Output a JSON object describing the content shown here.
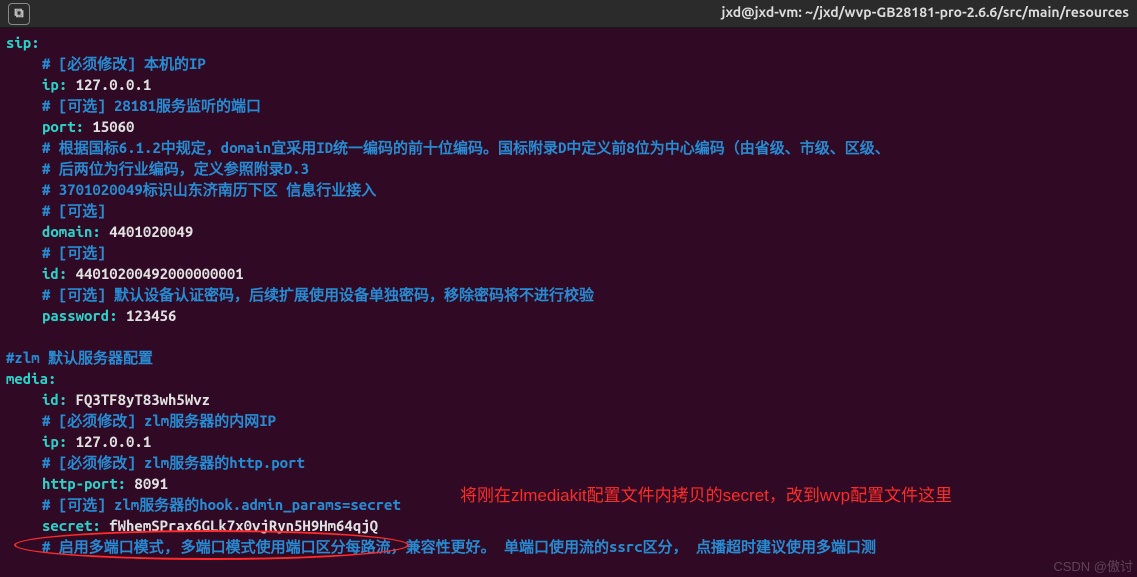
{
  "titlebar": {
    "title": "jxd@jxd-vm: ~/jxd/wvp-GB28181-pro-2.6.6/src/main/resources",
    "new_tab_icon_glyph": "⧉"
  },
  "lines": [
    {
      "indent": 0,
      "type": "key",
      "key": "sip",
      "value": ""
    },
    {
      "indent": 1,
      "type": "comment",
      "text": "# [必须修改] 本机的IP"
    },
    {
      "indent": 1,
      "type": "kv",
      "key": "ip",
      "value": "127.0.0.1"
    },
    {
      "indent": 1,
      "type": "comment",
      "text": "# [可选] 28181服务监听的端口"
    },
    {
      "indent": 1,
      "type": "kv",
      "key": "port",
      "value": "15060"
    },
    {
      "indent": 1,
      "type": "comment",
      "text": "# 根据国标6.1.2中规定，domain宜采用ID统一编码的前十位编码。国标附录D中定义前8位为中心编码（由省级、市级、区级、"
    },
    {
      "indent": 1,
      "type": "comment",
      "text": "# 后两位为行业编码，定义参照附录D.3"
    },
    {
      "indent": 1,
      "type": "comment",
      "text": "# 3701020049标识山东济南历下区 信息行业接入"
    },
    {
      "indent": 1,
      "type": "comment",
      "text": "# [可选]"
    },
    {
      "indent": 1,
      "type": "kv",
      "key": "domain",
      "value": "4401020049"
    },
    {
      "indent": 1,
      "type": "comment",
      "text": "# [可选]"
    },
    {
      "indent": 1,
      "type": "kv",
      "key": "id",
      "value": "44010200492000000001"
    },
    {
      "indent": 1,
      "type": "comment",
      "text": "# [可选] 默认设备认证密码，后续扩展使用设备单独密码，移除密码将不进行校验"
    },
    {
      "indent": 1,
      "type": "kv",
      "key": "password",
      "value": "123456"
    },
    {
      "indent": 0,
      "type": "blank"
    },
    {
      "indent": 0,
      "type": "comment",
      "text": "#zlm 默认服务器配置"
    },
    {
      "indent": 0,
      "type": "key",
      "key": "media",
      "value": ""
    },
    {
      "indent": 1,
      "type": "kv",
      "key": "id",
      "value": "FQ3TF8yT83wh5Wvz"
    },
    {
      "indent": 1,
      "type": "comment",
      "text": "# [必须修改] zlm服务器的内网IP"
    },
    {
      "indent": 1,
      "type": "kv",
      "key": "ip",
      "value": "127.0.0.1"
    },
    {
      "indent": 1,
      "type": "comment",
      "text": "# [必须修改] zlm服务器的http.port"
    },
    {
      "indent": 1,
      "type": "kv",
      "key": "http-port",
      "value": "8091"
    },
    {
      "indent": 1,
      "type": "comment",
      "text": "# [可选] zlm服务器的hook.admin_params=secret"
    },
    {
      "indent": 1,
      "type": "kv",
      "key": "secret",
      "value": "fWhemSPrax6GLk7x0vjRyn5H9Hm64qjQ"
    },
    {
      "indent": 1,
      "type": "comment",
      "text": "# 启用多端口模式, 多端口模式使用端口区分每路流，兼容性更好。 单端口使用流的ssrc区分， 点播超时建议使用多端口测"
    }
  ],
  "annotation": {
    "text": "将刚在zlmediakit配置文件内拷贝的secret，改到wvp配置文件这里"
  },
  "watermark": "CSDN @傲讨"
}
